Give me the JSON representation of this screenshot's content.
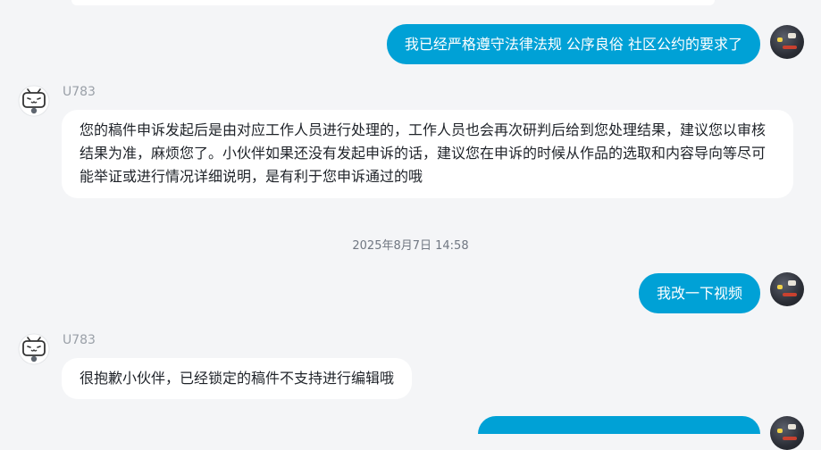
{
  "messages": {
    "m1": {
      "text": "我已经严格遵守法律法规 公序良俗 社区公约的要求了"
    },
    "m2": {
      "sender": "U783",
      "text": "您的稿件申诉发起后是由对应工作人员进行处理的，工作人员也会再次研判后给到您处理结果，建议您以审核结果为准，麻烦您了。小伙伴如果还没有发起申诉的话，建议您在申诉的时候从作品的选取和内容导向等尽可能举证或进行情况详细说明，是有利于您申诉通过的哦"
    },
    "timestamp": "2025年8月7日 14:58",
    "m3": {
      "text": "我改一下视频"
    },
    "m4": {
      "sender": "U783",
      "text": "很抱歉小伙伴，已经锁定的稿件不支持进行编辑哦"
    }
  },
  "colors": {
    "outgoing_bubble": "#00a1d6",
    "incoming_bubble": "#ffffff",
    "background": "#f4f5f7"
  },
  "icons": [
    "user-avatar",
    "bot-avatar-tv-mascot"
  ]
}
